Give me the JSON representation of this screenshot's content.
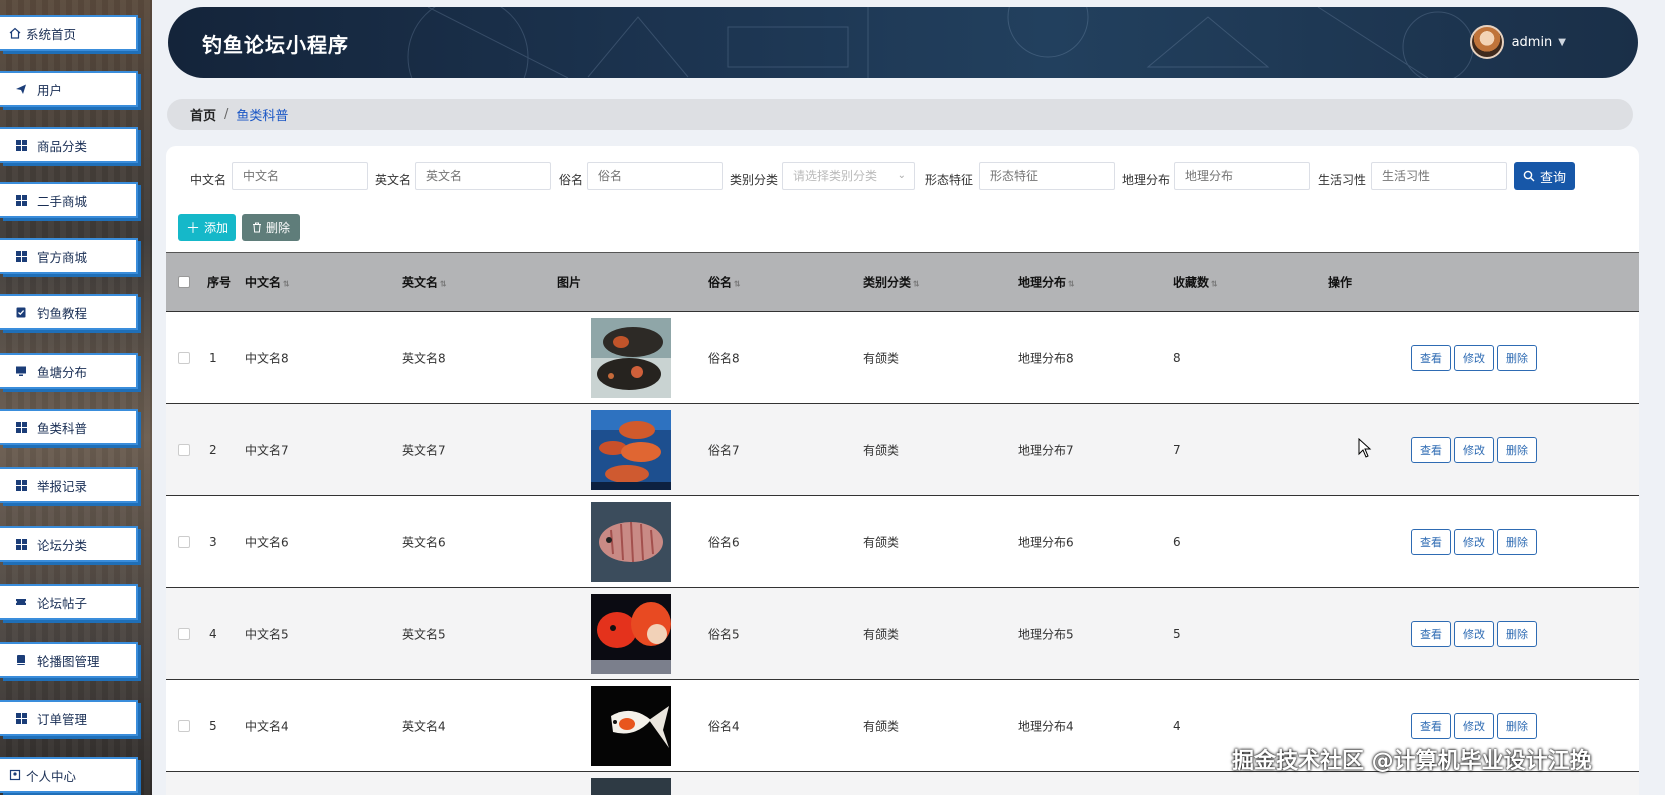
{
  "sidebar": {
    "items": [
      {
        "label": "系统首页",
        "icon": "home-icon"
      },
      {
        "label": "用户",
        "icon": "send-icon"
      },
      {
        "label": "商品分类",
        "icon": "grid-icon"
      },
      {
        "label": "二手商城",
        "icon": "grid-icon"
      },
      {
        "label": "官方商城",
        "icon": "grid-icon"
      },
      {
        "label": "钓鱼教程",
        "icon": "clipboard-check-icon"
      },
      {
        "label": "鱼塘分布",
        "icon": "monitor-icon"
      },
      {
        "label": "鱼类科普",
        "icon": "grid-icon"
      },
      {
        "label": "举报记录",
        "icon": "grid-icon"
      },
      {
        "label": "论坛分类",
        "icon": "grid-icon"
      },
      {
        "label": "论坛帖子",
        "icon": "ticket-icon"
      },
      {
        "label": "轮播图管理",
        "icon": "book-icon"
      },
      {
        "label": "订单管理",
        "icon": "grid-icon"
      },
      {
        "label": "个人中心",
        "icon": "user-icon"
      }
    ]
  },
  "header": {
    "title": "钓鱼论坛小程序",
    "username": "admin"
  },
  "breadcrumb": {
    "home": "首页",
    "separator": "/",
    "current": "鱼类科普"
  },
  "search": {
    "fields": [
      {
        "label": "中文名",
        "placeholder": "中文名"
      },
      {
        "label": "英文名",
        "placeholder": "英文名"
      },
      {
        "label": "俗名",
        "placeholder": "俗名"
      },
      {
        "label": "类别分类",
        "placeholder": "请选择类别分类"
      },
      {
        "label": "形态特征",
        "placeholder": "形态特征"
      },
      {
        "label": "地理分布",
        "placeholder": "地理分布"
      },
      {
        "label": "生活习性",
        "placeholder": "生活习性"
      }
    ],
    "query_label": "查询"
  },
  "actions": {
    "add_label": "添加",
    "delete_label": "删除"
  },
  "table": {
    "columns": [
      "序号",
      "中文名",
      "英文名",
      "图片",
      "俗名",
      "类别分类",
      "地理分布",
      "收藏数",
      "操作"
    ],
    "rows": [
      {
        "index": "1",
        "cn_name": "中文名8",
        "en_name": "英文名8",
        "common_name": "俗名8",
        "category": "有颌类",
        "region": "地理分布8",
        "favorites": "8",
        "image": "oscar-fish-dark"
      },
      {
        "index": "2",
        "cn_name": "中文名7",
        "en_name": "英文名7",
        "common_name": "俗名7",
        "category": "有颌类",
        "region": "地理分布7",
        "favorites": "7",
        "image": "oscar-fish-aquarium"
      },
      {
        "index": "3",
        "cn_name": "中文名6",
        "en_name": "英文名6",
        "common_name": "俗名6",
        "category": "有颌类",
        "region": "地理分布6",
        "favorites": "6",
        "image": "striped-cichlid"
      },
      {
        "index": "4",
        "cn_name": "中文名5",
        "en_name": "英文名5",
        "common_name": "俗名5",
        "category": "有颌类",
        "region": "地理分布5",
        "favorites": "5",
        "image": "red-parrot-fish"
      },
      {
        "index": "5",
        "cn_name": "中文名4",
        "en_name": "英文名4",
        "common_name": "俗名4",
        "category": "有颌类",
        "region": "地理分布4",
        "favorites": "4",
        "image": "goldfish"
      }
    ],
    "row_actions": {
      "view": "查看",
      "edit": "修改",
      "delete": "删除"
    }
  },
  "watermark": "掘金技术社区 @计算机毕业设计江挽",
  "colors": {
    "accent": "#1757a8",
    "add": "#15b8c9",
    "delete": "#5f7d7a",
    "header_bg": "#1c3450",
    "breadcrumb_active": "#1a56c5"
  }
}
